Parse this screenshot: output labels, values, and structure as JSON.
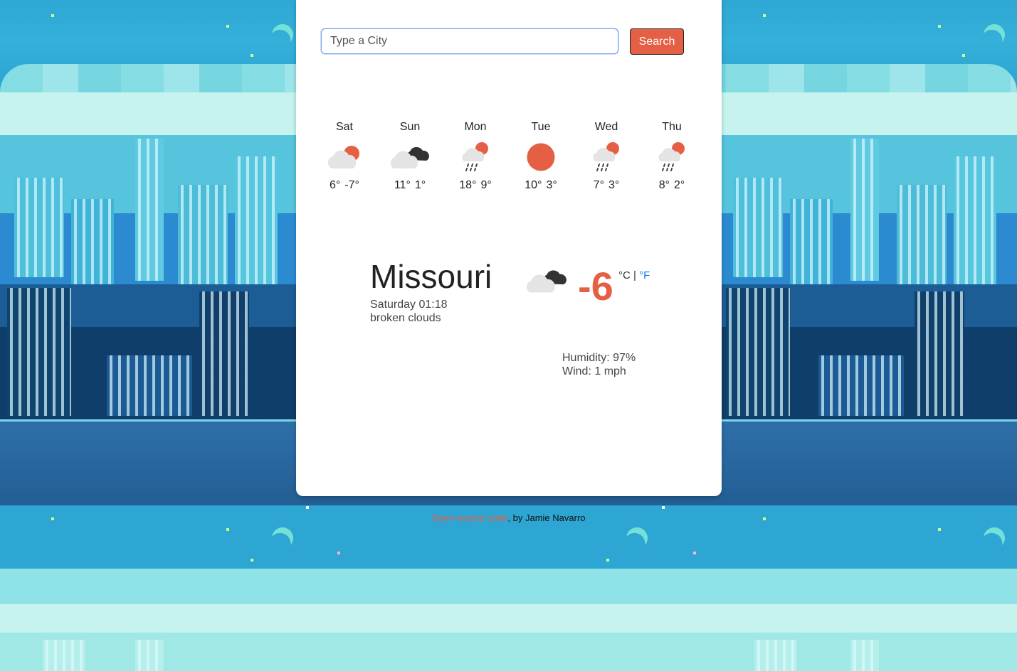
{
  "search": {
    "placeholder": "Type a City",
    "value": "",
    "button_label": "Search"
  },
  "forecast": [
    {
      "day": "Sat",
      "icon": "few-clouds-day-icon",
      "max": "6°",
      "min": "-7°"
    },
    {
      "day": "Sun",
      "icon": "broken-clouds-icon",
      "max": "11°",
      "min": "1°"
    },
    {
      "day": "Mon",
      "icon": "rain-day-icon",
      "max": "18°",
      "min": "9°"
    },
    {
      "day": "Tue",
      "icon": "clear-sun-icon",
      "max": "10°",
      "min": "3°"
    },
    {
      "day": "Wed",
      "icon": "rain-day-icon",
      "max": "7°",
      "min": "3°"
    },
    {
      "day": "Thu",
      "icon": "rain-day-icon",
      "max": "8°",
      "min": "2°"
    }
  ],
  "current": {
    "city": "Missouri",
    "date_time": "Saturday 01:18",
    "description": "broken clouds",
    "icon": "broken-clouds-icon",
    "temperature": "-6",
    "unit_c": "°C",
    "unit_separator": "|",
    "unit_f": "°F",
    "humidity_label": "Humidity: 97%",
    "wind_label": "Wind: 1 mph"
  },
  "footer": {
    "link_text": "Open-source code",
    "author_text": ", by Jamie Navarro"
  },
  "colors": {
    "accent": "#e55f45",
    "link_blue": "#1a73e8",
    "card_bg": "#ffffff"
  }
}
